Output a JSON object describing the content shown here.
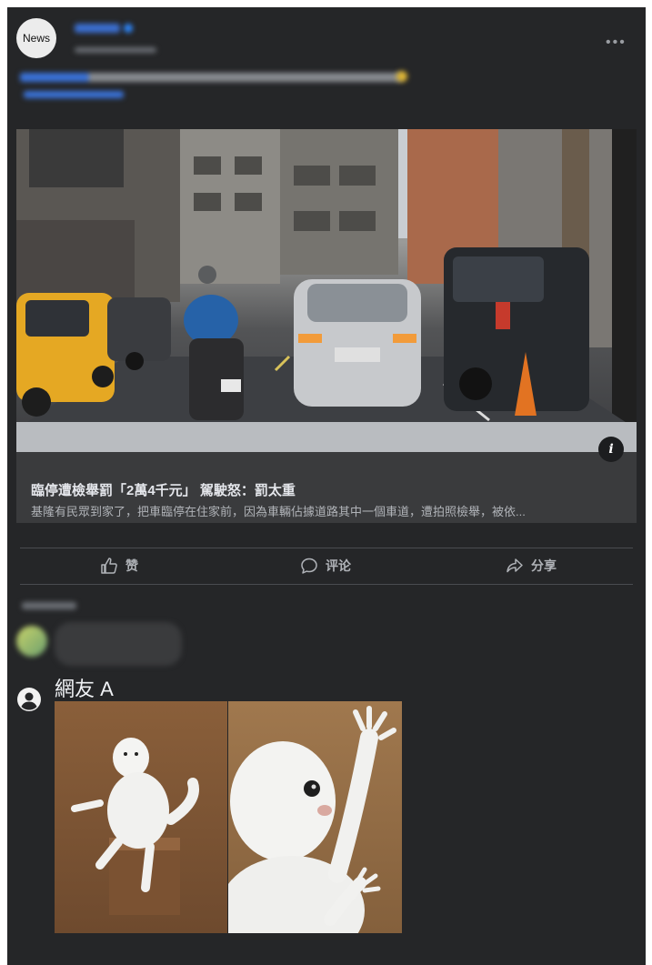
{
  "post": {
    "avatar_label": "News",
    "more_icon": "ellipsis-icon"
  },
  "link": {
    "title": "臨停遭檢舉罰「2萬4千元」 駕駛怒：罰太重",
    "description": "基隆有民眾到家了，把車臨停在住家前，因為車輛佔據道路其中一個車道，遭拍照檢舉，被依...",
    "info_icon": "i"
  },
  "actions": [
    {
      "label": "赞",
      "icon": "thumbs-up-icon"
    },
    {
      "label": "评论",
      "icon": "comment-icon"
    },
    {
      "label": "分享",
      "icon": "share-icon"
    }
  ],
  "comment": {
    "author": "網友 A",
    "avatar_icon": "user-icon"
  },
  "colors": {
    "post_bg": "#252628",
    "card_bg": "#3a3b3d",
    "text_primary": "#e4e6eb",
    "text_secondary": "#b0b3b8",
    "link_blue": "#3a72d8"
  }
}
